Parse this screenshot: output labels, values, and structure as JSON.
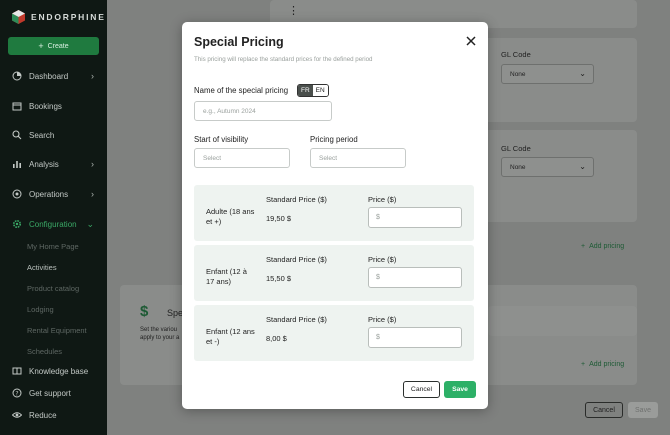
{
  "sidebar": {
    "brand": "ENDORPHINE",
    "create_label": "Create",
    "items": [
      {
        "label": "Dashboard",
        "icon": "dashboard-icon",
        "chevron": true
      },
      {
        "label": "Bookings",
        "icon": "calendar-icon",
        "chevron": false
      },
      {
        "label": "Search",
        "icon": "search-icon",
        "chevron": false
      },
      {
        "label": "Analysis",
        "icon": "chart-icon",
        "chevron": true
      },
      {
        "label": "Operations",
        "icon": "operations-icon",
        "chevron": true
      },
      {
        "label": "Configuration",
        "icon": "gear-icon",
        "chevron": true
      }
    ],
    "sub_items": [
      "My Home Page",
      "Activities",
      "Product catalog",
      "Lodging",
      "Rental Equipment",
      "Schedules"
    ],
    "bottom_items": [
      {
        "label": "Knowledge base",
        "icon": "book-icon"
      },
      {
        "label": "Get support",
        "icon": "help-icon"
      },
      {
        "label": "Reduce",
        "icon": "eye-icon"
      }
    ]
  },
  "background": {
    "gl_code_label": "GL Code",
    "gl_select_value": "None",
    "add_pricing_label": "Add pricing",
    "section_title_partial": "Spe",
    "section_desc_partial_1": "Set the variou",
    "section_desc_partial_2": "apply to your a",
    "cancel_label": "Cancel",
    "save_label": "Save"
  },
  "modal": {
    "title": "Special Pricing",
    "subtitle": "This pricing will replace the standard prices for the defined period",
    "name_label": "Name of the special pricing",
    "lang_fr": "FR",
    "lang_en": "EN",
    "name_placeholder": "e.g., Autumn 2024",
    "visibility_label": "Start of visibility",
    "visibility_placeholder": "Select",
    "period_label": "Pricing period",
    "period_placeholder": "Select",
    "std_header": "Standard Price ($)",
    "price_header": "Price ($)",
    "price_placeholder": "$",
    "rows": [
      {
        "category": "Adulte (18 ans et +)",
        "standard": "19,50 $"
      },
      {
        "category": "Enfant (12 à 17 ans)",
        "standard": "15,50 $"
      },
      {
        "category": "Enfant (12 ans et -)",
        "standard": "8,00 $"
      }
    ],
    "cancel_label": "Cancel",
    "save_label": "Save"
  },
  "colors": {
    "accent": "#2db067",
    "sidebar_bg": "#0f1814",
    "active_nav": "#3aa866"
  }
}
